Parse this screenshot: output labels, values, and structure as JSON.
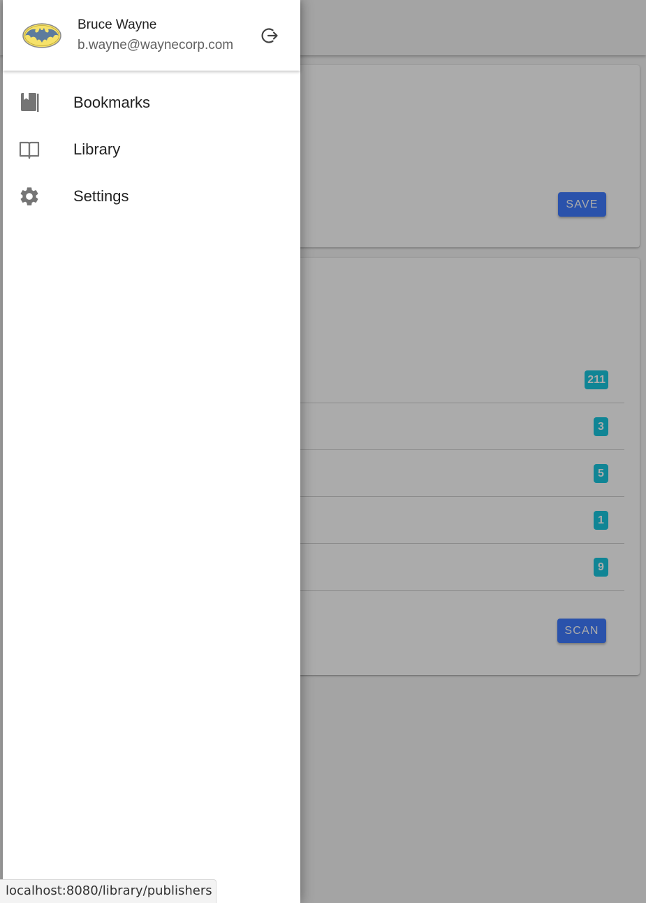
{
  "user": {
    "name": "Bruce Wayne",
    "email": "b.wayne@waynecorp.com"
  },
  "nav": {
    "items": [
      {
        "label": "Bookmarks",
        "icon": "bookmark-book-icon"
      },
      {
        "label": "Library",
        "icon": "open-book-icon"
      },
      {
        "label": "Settings",
        "icon": "gear-icon"
      }
    ]
  },
  "background": {
    "save_label": "SAVE",
    "scan_label": "SCAN",
    "counts": [
      "211",
      "3",
      "5",
      "1",
      "9"
    ]
  },
  "status_bar": {
    "url": "localhost:8080/library/publishers"
  },
  "colors": {
    "primary": "#3f7bff",
    "badge": "#19c6de",
    "icon": "#757575"
  }
}
